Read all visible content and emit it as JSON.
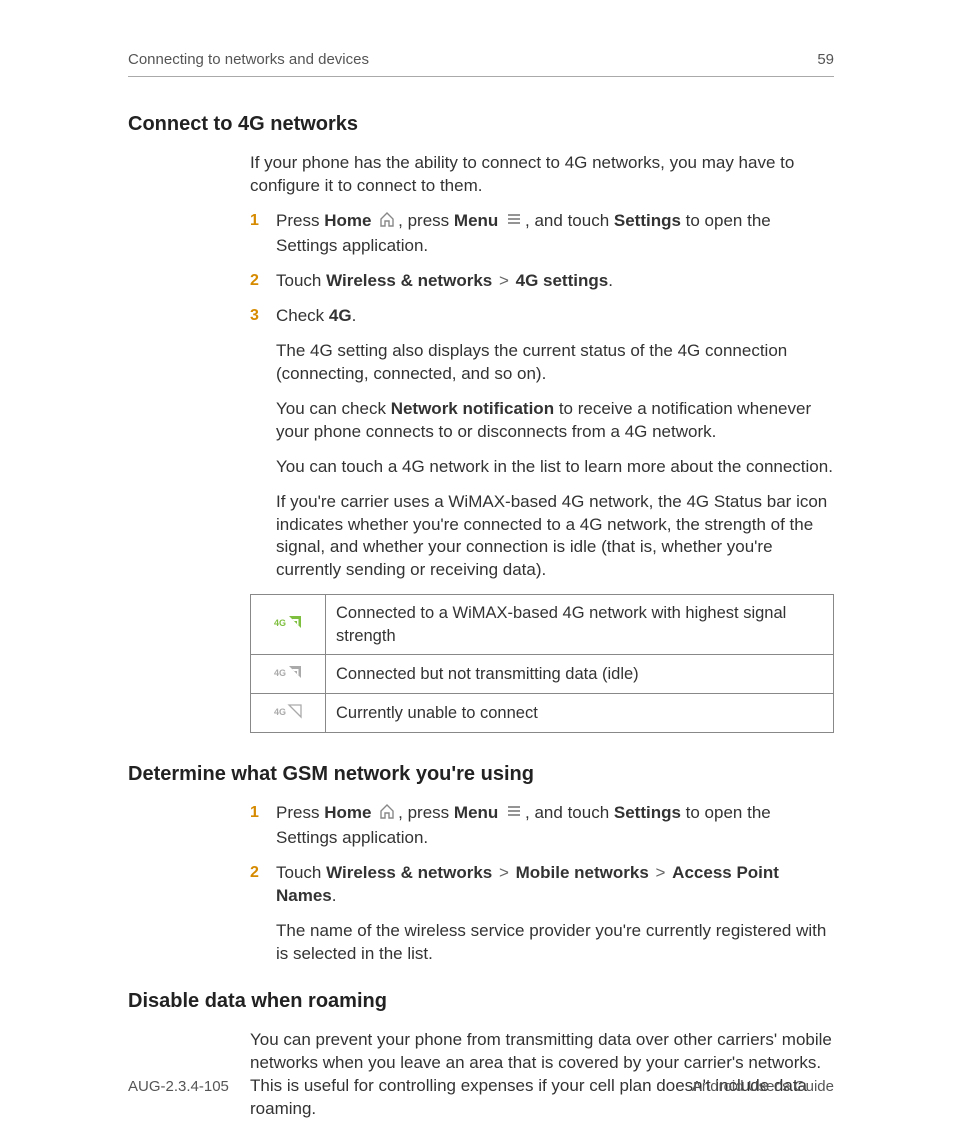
{
  "header": {
    "title": "Connecting to networks and devices",
    "page": "59"
  },
  "s1": {
    "heading": "Connect to 4G networks",
    "intro": "If your phone has the ability to connect to 4G networks, you may have to configure it to connect to them.",
    "step1": {
      "n": "1",
      "a": "Press ",
      "home": "Home",
      "b": ", press ",
      "menu": "Menu",
      "c": ", and touch ",
      "settings": "Settings",
      "d": " to open the Settings application."
    },
    "step2": {
      "n": "2",
      "a": "Touch ",
      "wn": "Wireless & networks",
      "b": " > ",
      "fg": "4G settings",
      "c": "."
    },
    "step3": {
      "n": "3",
      "a": "Check ",
      "fg": "4G",
      "b": ".",
      "p1": "The 4G setting also displays the current status of the 4G connection (connecting, connected, and so on).",
      "p2a": "You can check ",
      "p2b": "Network notification",
      "p2c": " to receive a notification whenever your phone connects to or disconnects from a 4G network.",
      "p3": "You can touch a 4G network in the list to learn more about the connection.",
      "p4": "If you're carrier uses a WiMAX-based 4G network, the 4G Status bar icon indicates whether you're connected to a 4G network, the strength of the signal, and whether your connection is idle (that is, whether you're currently sending or receiving data)."
    },
    "table": {
      "r1": "Connected to a WiMAX-based 4G network with highest signal strength",
      "r2": "Connected but not transmitting data (idle)",
      "r3": "Currently unable to connect"
    }
  },
  "s2": {
    "heading": "Determine what GSM network you're using",
    "step1": {
      "n": "1",
      "a": "Press ",
      "home": "Home",
      "b": ", press ",
      "menu": "Menu",
      "c": ", and touch ",
      "settings": "Settings",
      "d": " to open the Settings application."
    },
    "step2": {
      "n": "2",
      "a": "Touch ",
      "wn": "Wireless & networks",
      "b": " > ",
      "mn": "Mobile networks",
      "c": " > ",
      "apn": "Access Point Names",
      "d": ".",
      "p1": "The name of the wireless service provider you're currently registered with is selected in the list."
    }
  },
  "s3": {
    "heading": "Disable data when roaming",
    "p1": "You can prevent your phone from transmitting data over other carriers' mobile networks when you leave an area that is covered by your carrier's networks. This is useful for controlling expenses if your cell plan doesn't include data roaming."
  },
  "footer": {
    "left": "AUG-2.3.4-105",
    "right": "Android User's Guide"
  }
}
